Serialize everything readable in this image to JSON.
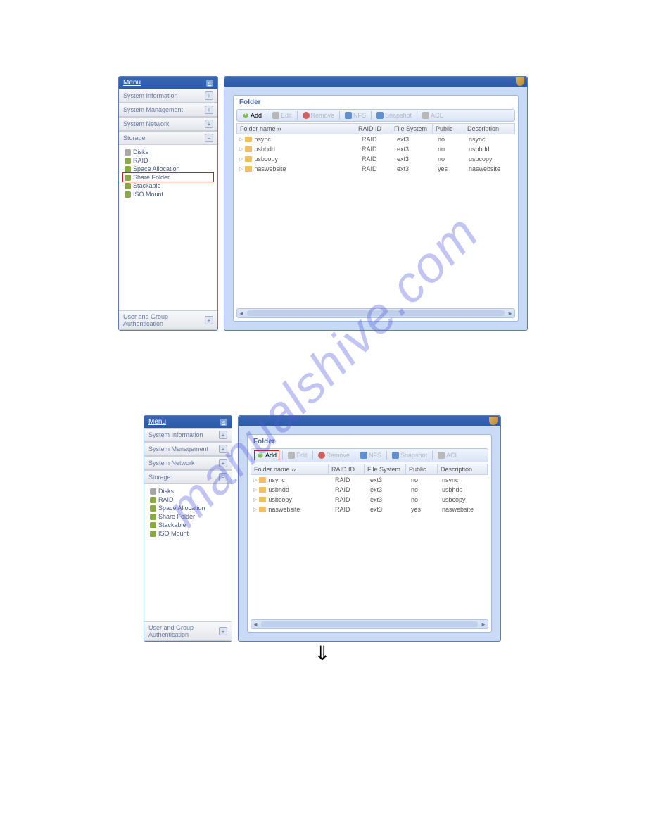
{
  "watermark": "manualshive.com",
  "sidebar": {
    "menu_title": "Menu",
    "sections": {
      "sys_info": "System Information",
      "sys_mgmt": "System Management",
      "sys_net": "System Network",
      "storage": "Storage",
      "user_auth": "User and Group Authentication"
    },
    "tree": {
      "disks": "Disks",
      "raid": "RAID",
      "space": "Space Allocation",
      "share": "Share Folder",
      "stack": "Stackable",
      "iso": "ISO Mount"
    }
  },
  "panel_title": "Folder",
  "toolbar": {
    "add": "Add",
    "edit": "Edit",
    "remove": "Remove",
    "nfs": "NFS",
    "snapshot": "Snapshot",
    "acl": "ACL"
  },
  "columns": {
    "name": "Folder name",
    "raid": "RAID ID",
    "fs": "File System",
    "public": "Public",
    "desc": "Description"
  },
  "rows": [
    {
      "name": "nsync",
      "raid": "RAID",
      "fs": "ext3",
      "public": "no",
      "desc": "nsync"
    },
    {
      "name": "usbhdd",
      "raid": "RAID",
      "fs": "ext3",
      "public": "no",
      "desc": "usbhdd"
    },
    {
      "name": "usbcopy",
      "raid": "RAID",
      "fs": "ext3",
      "public": "no",
      "desc": "usbcopy"
    },
    {
      "name": "naswebsite",
      "raid": "RAID",
      "fs": "ext3",
      "public": "yes",
      "desc": "naswebsite"
    }
  ]
}
